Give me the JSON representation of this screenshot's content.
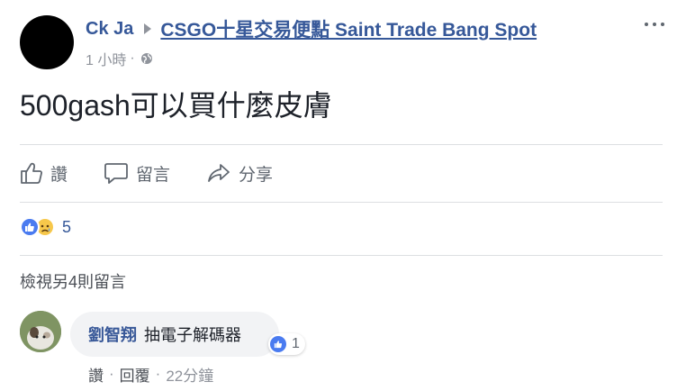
{
  "post": {
    "author": "Ck Ja",
    "group": "CSGO十星交易便點 Saint Trade Bang Spot",
    "time": "1 小時",
    "meta_separator": "·",
    "text": "500gash可以買什麼皮膚"
  },
  "actions": {
    "like": "讚",
    "comment": "留言",
    "share": "分享"
  },
  "reactions": {
    "types": [
      "like",
      "sad"
    ],
    "count": "5"
  },
  "comments": {
    "view_more": "檢視另4則留言",
    "items": [
      {
        "name": "劉智翔",
        "text": "抽電子解碼器",
        "likes": "1",
        "like_label": "讚",
        "reply_label": "回覆",
        "time": "22分鐘"
      }
    ]
  },
  "colors": {
    "link_blue": "#365899",
    "like_blue": "#4a7bf0",
    "sad_yellow": "#f7c84b",
    "muted_gray": "#90949c"
  }
}
